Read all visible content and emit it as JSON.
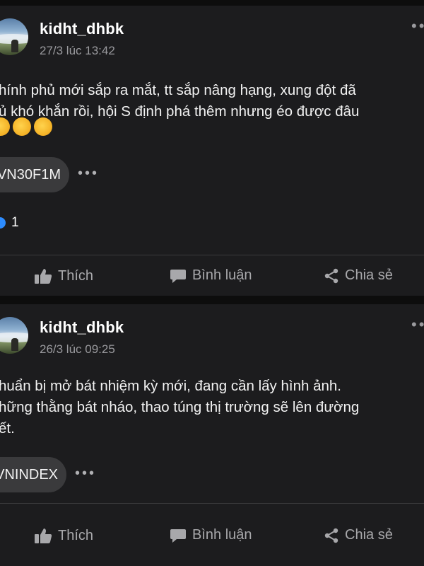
{
  "posts": [
    {
      "author": "kidht_dhbk",
      "timestamp": "27/3 lúc 13:42",
      "more": "••",
      "lines": [
        "hính phủ mới sắp ra mắt, tt sắp nâng hạng, xung đột đã",
        "ủ khó khắn rồi, hội S định phá thêm nhưng éo được đâu"
      ],
      "emoji_count": 3,
      "tag": "VN30F1M",
      "tag_more": "•••",
      "reaction_count": "1"
    },
    {
      "author": "kidht_dhbk",
      "timestamp": "26/3 lúc 09:25",
      "more": "••",
      "lines": [
        "huẩn bị mở bát nhiệm kỳ mới, đang cần lấy hình ảnh.",
        "hững thằng bát nháo, thao túng thị trường sẽ lên đường",
        "ết."
      ],
      "tag": "VNINDEX",
      "tag_more": "•••"
    }
  ],
  "actions": {
    "like": "Thích",
    "comment": "Bình luận",
    "share": "Chia sẻ"
  },
  "colors": {
    "background": "#0d0d0d",
    "card": "#1c1c1e",
    "muted_text": "#9a9a9e",
    "pill": "#3a3a3c",
    "like_blue": "#2d8cff"
  }
}
